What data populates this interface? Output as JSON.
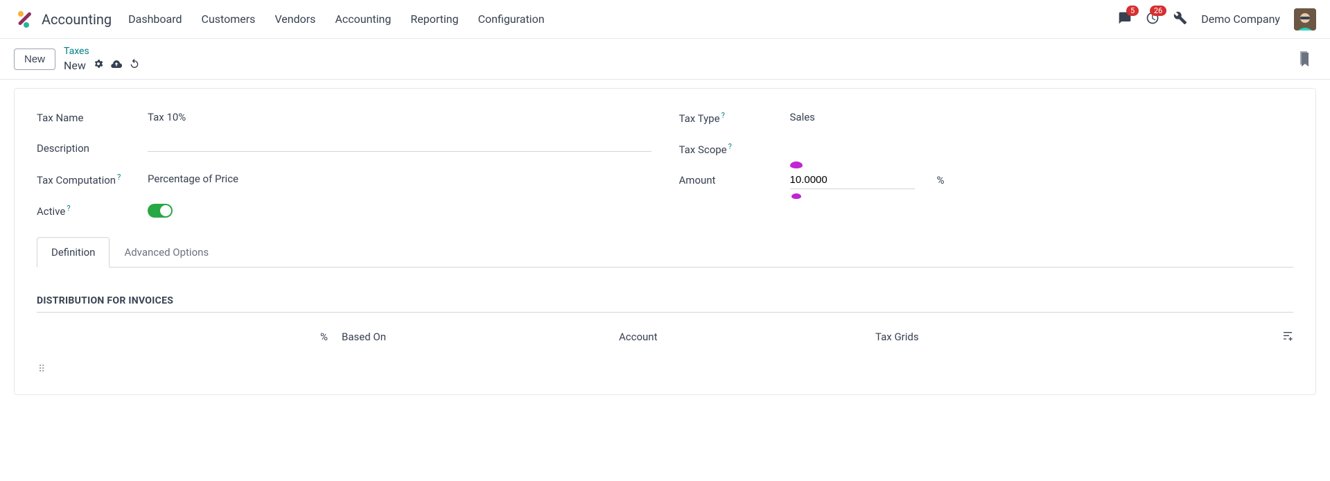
{
  "app_title": "Accounting",
  "nav": {
    "items": [
      "Dashboard",
      "Customers",
      "Vendors",
      "Accounting",
      "Reporting",
      "Configuration"
    ]
  },
  "topbar": {
    "messages_badge": "5",
    "activities_badge": "26",
    "company": "Demo Company"
  },
  "subheader": {
    "new_btn": "New",
    "breadcrumb_parent": "Taxes",
    "breadcrumb_current": "New"
  },
  "form": {
    "tax_name_label": "Tax Name",
    "tax_name_value": "Tax 10%",
    "description_label": "Description",
    "description_value": "",
    "tax_computation_label": "Tax Computation",
    "tax_computation_value": "Percentage of Price",
    "active_label": "Active",
    "tax_type_label": "Tax Type",
    "tax_type_value": "Sales",
    "tax_scope_label": "Tax Scope",
    "tax_scope_value": "",
    "amount_label": "Amount",
    "amount_value": "10.0000",
    "amount_suffix": "%",
    "help": "?"
  },
  "tabs": {
    "definition": "Definition",
    "advanced": "Advanced Options"
  },
  "distribution": {
    "title": "DISTRIBUTION FOR INVOICES",
    "col_pct": "%",
    "col_based": "Based On",
    "col_account": "Account",
    "col_grids": "Tax Grids"
  }
}
